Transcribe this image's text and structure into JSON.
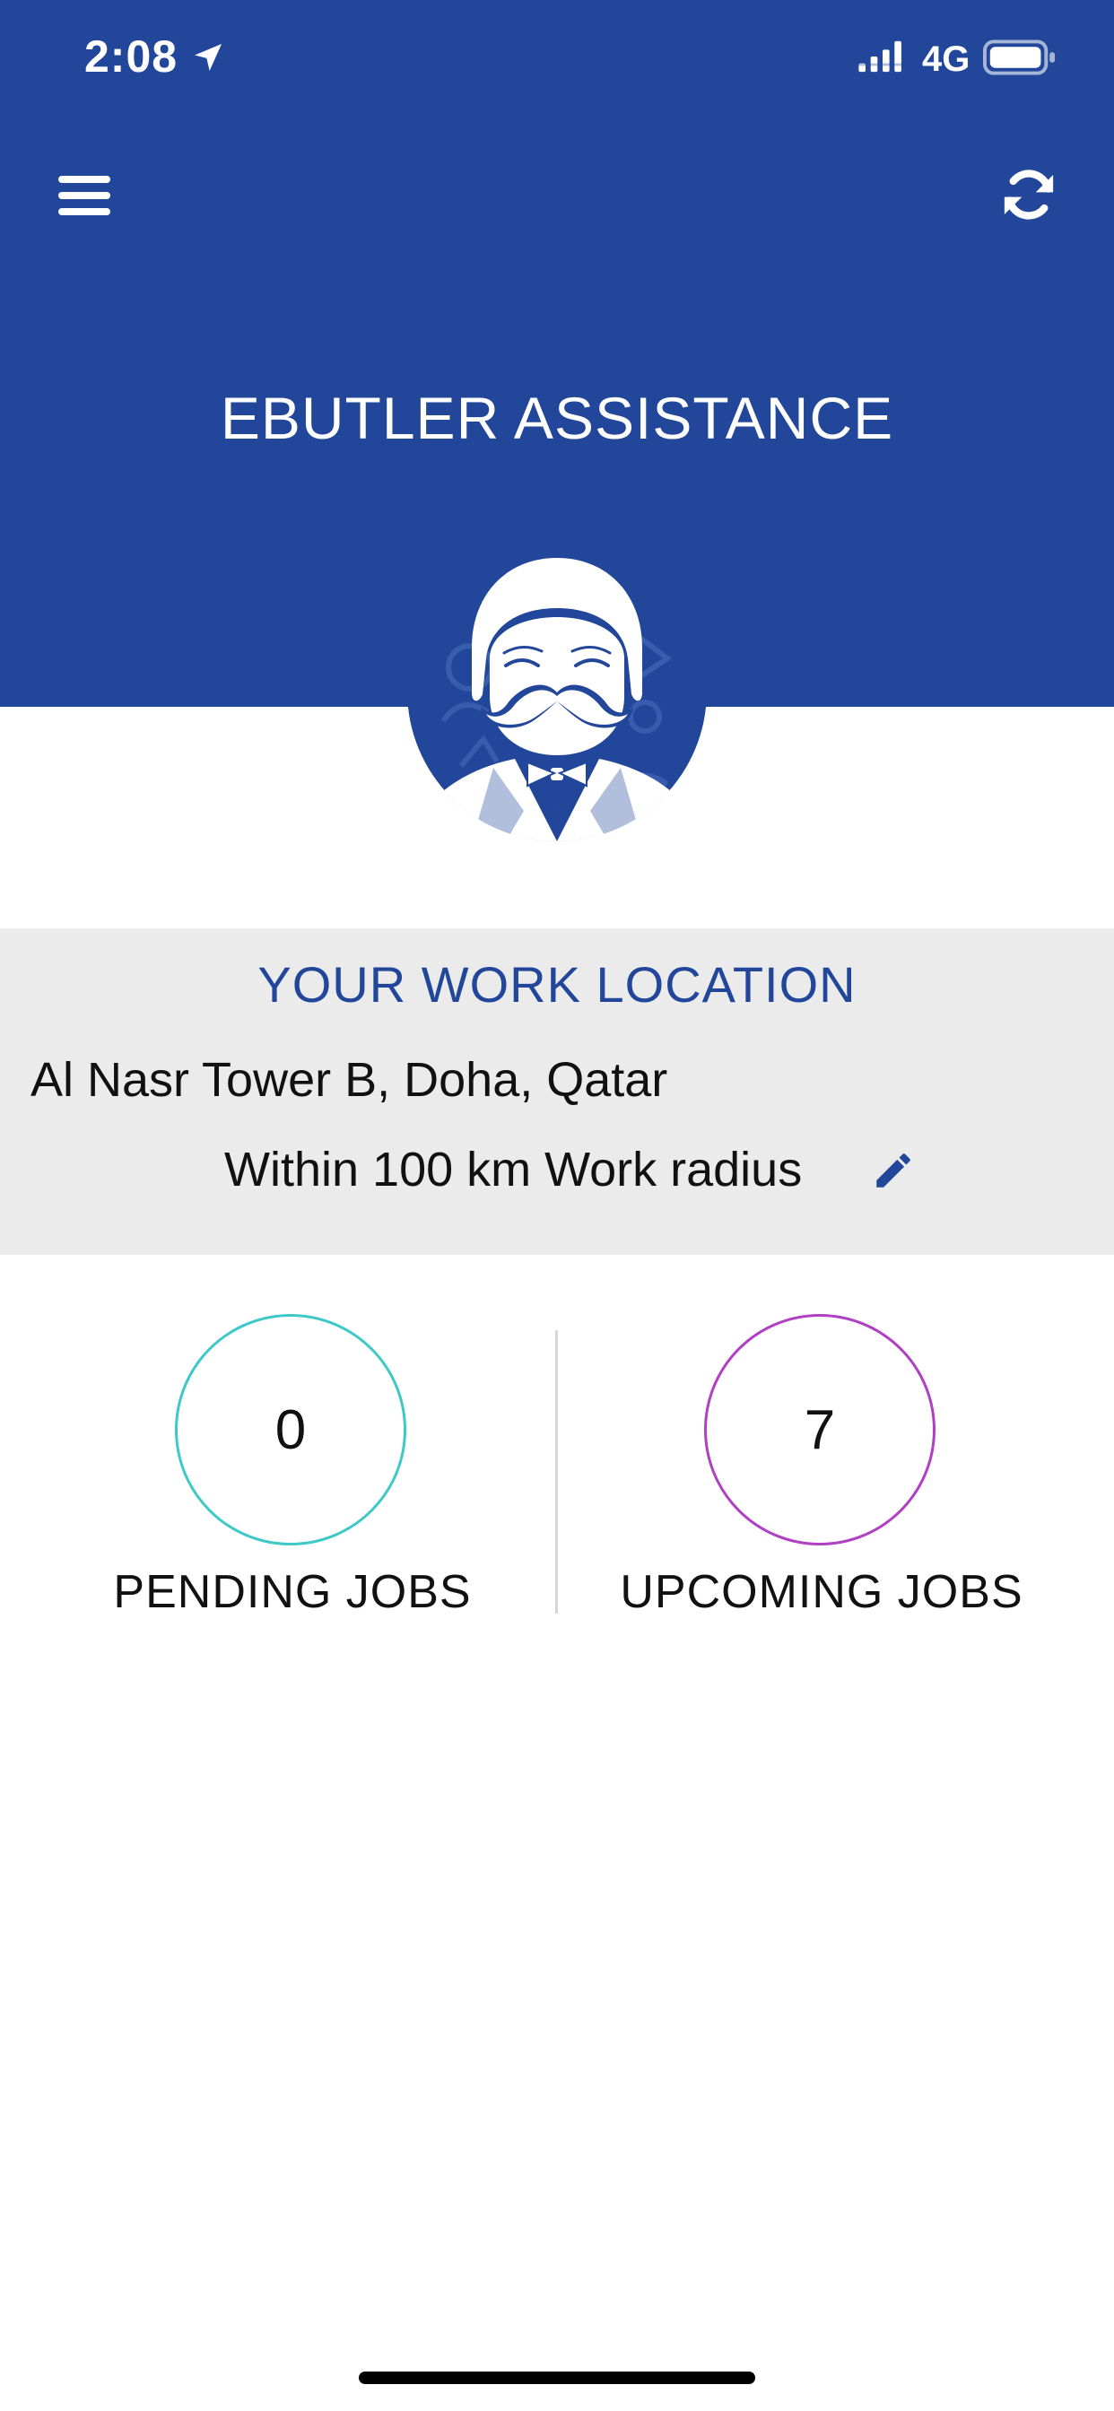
{
  "status_bar": {
    "time": "2:08",
    "network": "4G",
    "icons": [
      "location-arrow-icon",
      "signal-icon",
      "battery-icon"
    ]
  },
  "header": {
    "title": "EBUTLER ASSISTANCE",
    "menu_icon": "menu-icon",
    "refresh_icon": "refresh-icon",
    "background_color": "#22479a"
  },
  "avatar": {
    "icon": "butler-mustache-avatar"
  },
  "work_location": {
    "heading": "YOUR WORK LOCATION",
    "address": "Al Nasr Tower B, Doha, Qatar",
    "radius_text": "Within 100 km Work radius",
    "edit_icon": "pencil-icon",
    "background_color": "#ebebeb",
    "heading_color": "#22479a"
  },
  "jobs": {
    "pending": {
      "count": "0",
      "label": "PENDING JOBS",
      "ring_color": "#3ec8c8"
    },
    "upcoming": {
      "count": "7",
      "label": "UPCOMING JOBS",
      "ring_color": "#b03fc4"
    }
  }
}
